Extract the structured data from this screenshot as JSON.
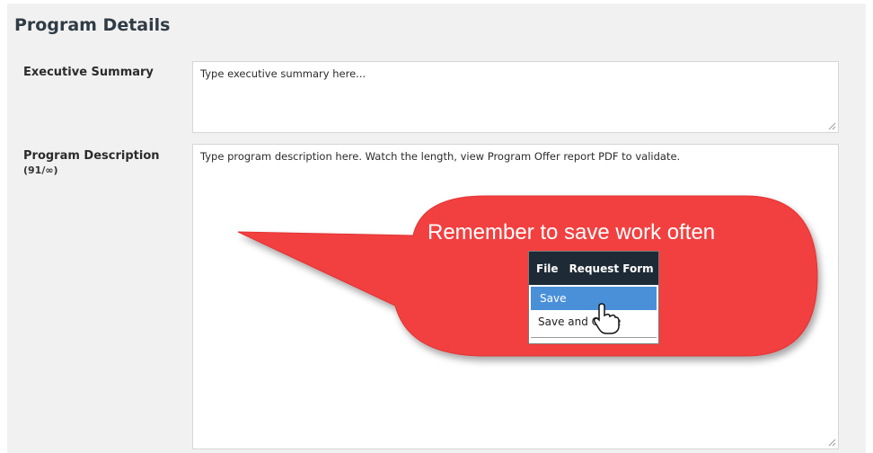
{
  "section": {
    "title": "Program Details"
  },
  "fields": {
    "executive_summary": {
      "label": "Executive Summary",
      "value": "Type executive summary here..."
    },
    "program_description": {
      "label": "Program Description",
      "counter": "(91/∞)",
      "value": "Type program description here. Watch the length, view Program Offer report PDF to validate."
    }
  },
  "callout": {
    "text": "Remember to save work often",
    "color": "#f24040",
    "menu": {
      "menubar": [
        "File",
        "Request Form"
      ],
      "items": [
        "Save",
        "Save and Close"
      ],
      "highlight_color": "#4a90d9"
    }
  },
  "icons": {
    "cursor": "hand-pointer-icon",
    "resize": "resize-grip-icon"
  }
}
